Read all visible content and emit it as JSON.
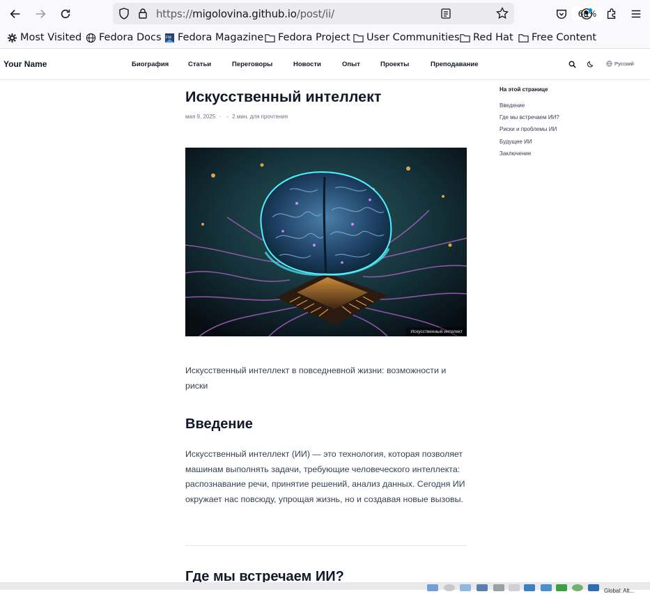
{
  "browser": {
    "url_scheme": "https://",
    "url_host": "migolovina.github.io",
    "url_path": "/post/ii/",
    "zoom": "60%",
    "bookmarks": [
      {
        "label": "Most Visited",
        "icon": "gear-icon"
      },
      {
        "label": "Fedora Docs",
        "icon": "globe-icon"
      },
      {
        "label": "Fedora Magazine",
        "icon": "fm-icon"
      },
      {
        "label": "Fedora Project",
        "icon": "folder-icon"
      },
      {
        "label": "User Communities",
        "icon": "folder-icon"
      },
      {
        "label": "Red Hat",
        "icon": "folder-icon"
      },
      {
        "label": "Free Content",
        "icon": "folder-icon"
      }
    ]
  },
  "site": {
    "brand": "Your Name",
    "nav": [
      "Биография",
      "Статьи",
      "Переговоры",
      "Новости",
      "Опыт",
      "Проекты",
      "Преподавание"
    ],
    "language": "Русский"
  },
  "article": {
    "title": "Искусственный интеллект",
    "date": "мая 9, 2025",
    "sep1": "·",
    "sep2": "-",
    "read_time": "2 мин. для прочтения",
    "image_caption": "Искусственный интелект",
    "lead": "Искусственный интеллект в повседневной жизни: возможности и риски",
    "intro_heading": "Введение",
    "intro_text": "Искусственный интеллект (ИИ) — это технология, которая позволяет машинам выполнять задачи, требующие человеческого интеллекта: распознавание речи, принятие решений, анализ данных. Сегодня ИИ окружает нас повсюду, упрощая жизнь, но и создавая новые вызовы.",
    "next_heading": "Где мы встречаем ИИ?"
  },
  "toc": {
    "title": "На этой странице",
    "items": [
      "Введение",
      "Где мы встречаем ИИ?",
      "Риски и проблемы ИИ",
      "Будущее ИИ",
      "Заключение"
    ]
  },
  "tray": {
    "clock_text": "Global: Alt..."
  },
  "colors": {
    "chrome_bg": "#f9f9fb",
    "urlbar_bg": "#ebebef",
    "text_primary": "#111827",
    "text_secondary": "#374151"
  }
}
